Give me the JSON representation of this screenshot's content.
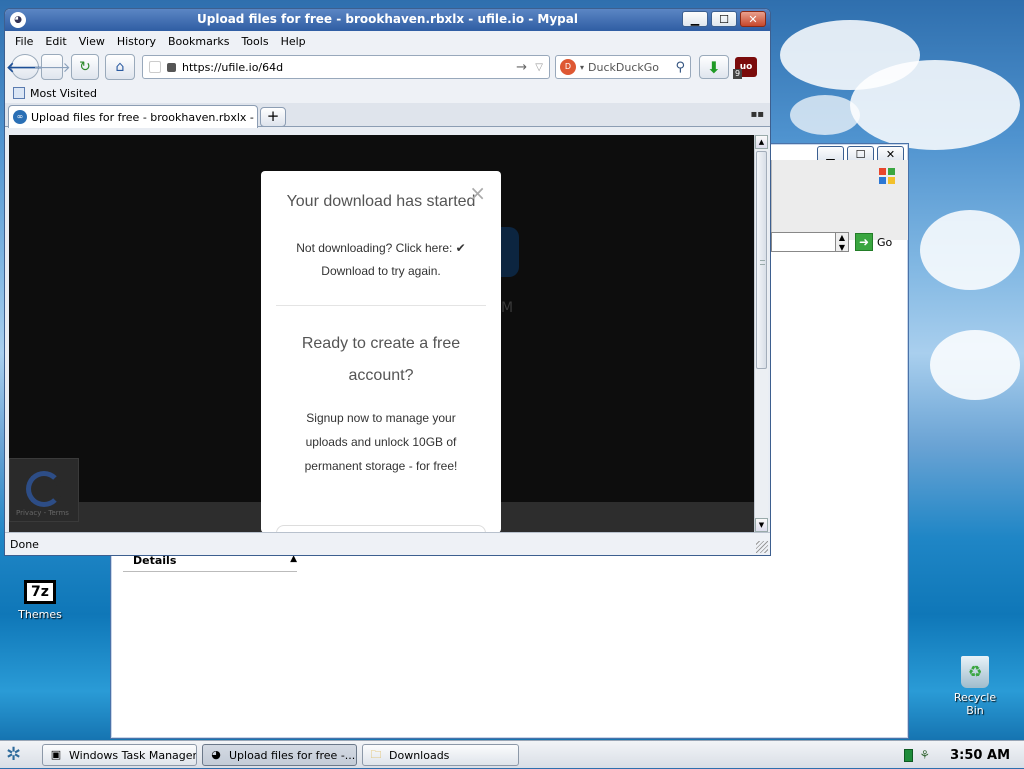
{
  "browser": {
    "title": "Upload files for free - brookhaven.rbxlx - ufile.io - Mypal",
    "menu": [
      "File",
      "Edit",
      "View",
      "History",
      "Bookmarks",
      "Tools",
      "Help"
    ],
    "url": "https://ufile.io/64d",
    "search_engine": "DuckDuckGo",
    "ublock_count": "9",
    "ublock_label": "uo",
    "bookmarks_label": "Most Visited",
    "tab_title": "Upload files for free - brookhaven.rbxlx - ufil...",
    "status": "Done"
  },
  "modal": {
    "heading": "Your download has started",
    "not_downloading": "Not downloading? Click here: ✔ Download to try again.",
    "ready_heading": "Ready to create a free account?",
    "signup_text": "Signup now to manage your uploads and unlock 10GB of permanent storage - for free!",
    "close_glyph": "×"
  },
  "page_bg": {
    "partial_text": "M",
    "recaptcha_footer": "Privacy - Terms"
  },
  "explorer": {
    "go_label": "Go",
    "details_label": "Details"
  },
  "desktop": {
    "icons": [
      {
        "label": "Themes",
        "glyph": "7z"
      },
      {
        "label": "Recycle Bin",
        "glyph": "♻"
      }
    ]
  },
  "taskbar": {
    "items": [
      {
        "label": "Windows Task Manager"
      },
      {
        "label": "Upload files for free -..."
      },
      {
        "label": "Downloads"
      }
    ],
    "clock": "3:50 AM"
  },
  "colors": {
    "titlebar": "#2f5da3",
    "modal_bg": "#ffffff",
    "page_bg": "#0d0d0d",
    "accent_green": "#3aa640"
  }
}
